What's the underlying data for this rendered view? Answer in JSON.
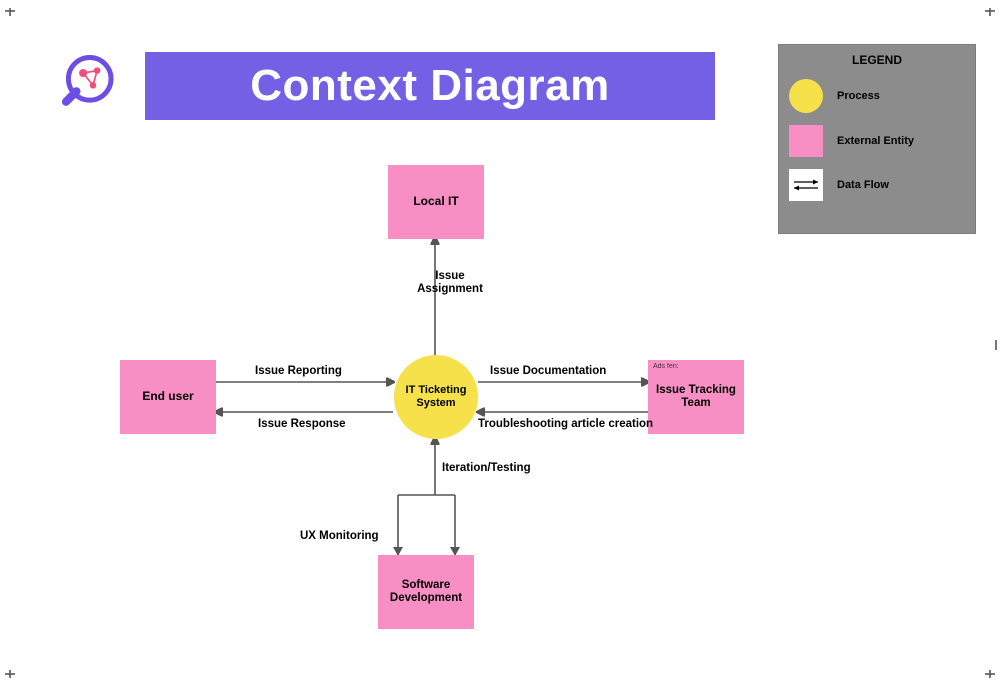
{
  "title": "Context Diagram",
  "legend": {
    "title": "LEGEND",
    "items": [
      {
        "type": "process",
        "label": "Process"
      },
      {
        "type": "entity",
        "label": "External Entity"
      },
      {
        "type": "dataflow",
        "label": "Data Flow"
      }
    ]
  },
  "process": {
    "id": "it-ticketing-system",
    "label": "IT Ticketing System"
  },
  "entities": {
    "local_it": {
      "label": "Local IT"
    },
    "end_user": {
      "label": "End user"
    },
    "tracking": {
      "label": "Issue Tracking Team",
      "ad_text": "Ads fen:"
    },
    "software": {
      "label": "Software Development"
    }
  },
  "flows": {
    "issue_reporting": "Issue Reporting",
    "issue_response": "Issue Response",
    "issue_assignment": "Issue Assignment",
    "issue_documentation": "Issue Documentation",
    "troubleshooting": "Troubleshooting article creation",
    "ux_monitoring": "UX Monitoring",
    "iteration_testing": "Iteration/Testing"
  },
  "colors": {
    "banner": "#7460E5",
    "process": "#F7E14A",
    "entity": "#F88FC4",
    "legend_bg": "#8C8C8C"
  }
}
